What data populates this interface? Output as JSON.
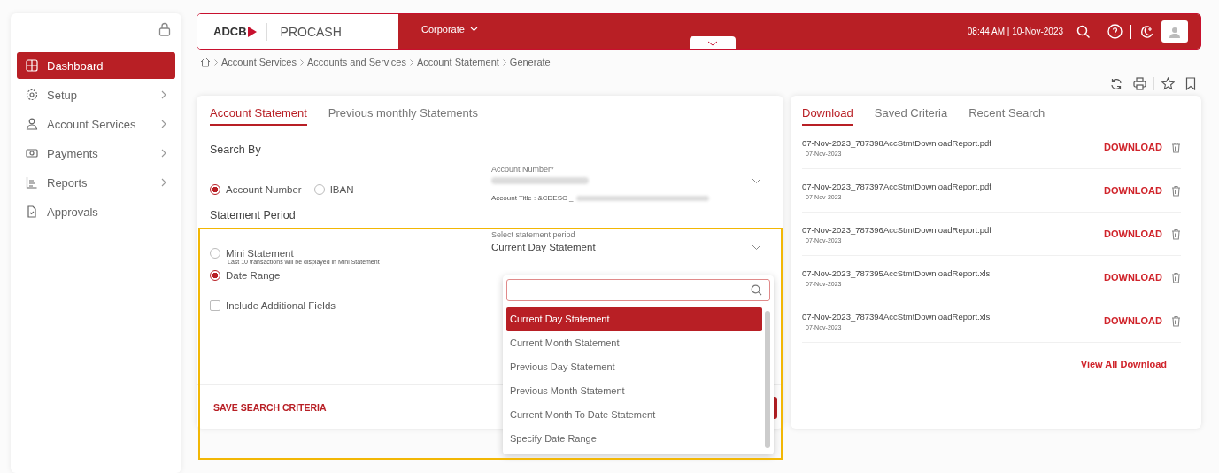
{
  "sidebar": {
    "items": [
      {
        "label": "Dashboard",
        "selected": true,
        "submenu": false
      },
      {
        "label": "Setup",
        "selected": false,
        "submenu": true
      },
      {
        "label": "Account Services",
        "selected": false,
        "submenu": true
      },
      {
        "label": "Payments",
        "selected": false,
        "submenu": true
      },
      {
        "label": "Reports",
        "selected": false,
        "submenu": true
      },
      {
        "label": "Approvals",
        "selected": false,
        "submenu": false
      }
    ]
  },
  "header": {
    "logo": "ADCB",
    "product": "PROCASH",
    "menu": "Corporate",
    "datetime": "08:44 AM | 10-Nov-2023"
  },
  "breadcrumb": [
    "Account Services",
    "Accounts and Services",
    "Account Statement",
    "Generate"
  ],
  "statement_tabs": [
    {
      "label": "Account Statement",
      "selected": true
    },
    {
      "label": "Previous monthly Statements",
      "selected": false
    }
  ],
  "search_by": {
    "title": "Search By",
    "options": [
      {
        "label": "Account Number",
        "selected": true
      },
      {
        "label": "IBAN",
        "selected": false
      }
    ],
    "account_field": {
      "label": "Account Number*",
      "title_prefix": "Account Title : &CDESC _"
    }
  },
  "statement_period": {
    "title": "Statement Period",
    "options": [
      {
        "label": "Mini Statement",
        "hint": "Last 10 transactions will be displayed in Mini Statement",
        "selected": false
      },
      {
        "label": "Date Range",
        "selected": true
      }
    ],
    "additional_fields": {
      "label": "Include Additional Fields",
      "checked": false
    },
    "period_field": {
      "label": "Select statement period",
      "value": "Current Day Statement"
    },
    "dropdown": [
      {
        "label": "Current Day Statement",
        "selected": true
      },
      {
        "label": "Current Month Statement",
        "selected": false
      },
      {
        "label": "Previous Day Statement",
        "selected": false
      },
      {
        "label": "Previous Month Statement",
        "selected": false
      },
      {
        "label": "Current Month To Date Statement",
        "selected": false
      },
      {
        "label": "Specify Date Range",
        "selected": false
      }
    ]
  },
  "save_criteria": "SAVE SEARCH CRITERIA",
  "download_tabs": [
    {
      "label": "Download",
      "selected": true
    },
    {
      "label": "Saved Criteria",
      "selected": false
    },
    {
      "label": "Recent Search",
      "selected": false
    }
  ],
  "downloads": [
    {
      "file": "07-Nov-2023_787398AccStmtDownloadReport.pdf",
      "date": "07-Nov-2023",
      "action": "DOWNLOAD"
    },
    {
      "file": "07-Nov-2023_787397AccStmtDownloadReport.pdf",
      "date": "07-Nov-2023",
      "action": "DOWNLOAD"
    },
    {
      "file": "07-Nov-2023_787396AccStmtDownloadReport.pdf",
      "date": "07-Nov-2023",
      "action": "DOWNLOAD"
    },
    {
      "file": "07-Nov-2023_787395AccStmtDownloadReport.xls",
      "date": "07-Nov-2023",
      "action": "DOWNLOAD"
    },
    {
      "file": "07-Nov-2023_787394AccStmtDownloadReport.xls",
      "date": "07-Nov-2023",
      "action": "DOWNLOAD"
    }
  ],
  "view_all": "View All Download"
}
